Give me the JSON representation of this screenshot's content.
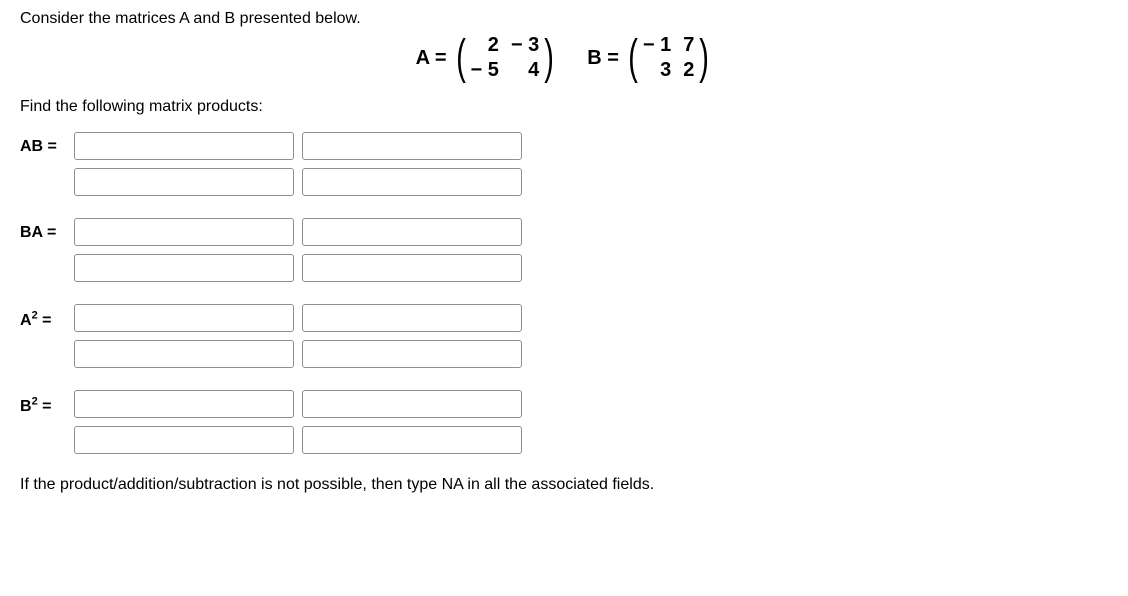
{
  "intro": "Consider the matrices A and B presented below.",
  "matrixA": {
    "label": "A =",
    "r1c1": "2",
    "r1c2": "− 3",
    "r2c1": "− 5",
    "r2c2": "4"
  },
  "matrixB": {
    "label": "B =",
    "r1c1": "− 1",
    "r1c2": "7",
    "r2c1": "3",
    "r2c2": "2"
  },
  "subhead": "Find the following matrix products:",
  "products": {
    "ab": {
      "label": "AB ="
    },
    "ba": {
      "label": "BA ="
    },
    "a2": {
      "prefix": "A",
      "sup": "2",
      "suffix": " ="
    },
    "b2": {
      "prefix": "B",
      "sup": "2",
      "suffix": " ="
    }
  },
  "note": "If the product/addition/subtraction is not possible, then type NA in all the associated fields."
}
